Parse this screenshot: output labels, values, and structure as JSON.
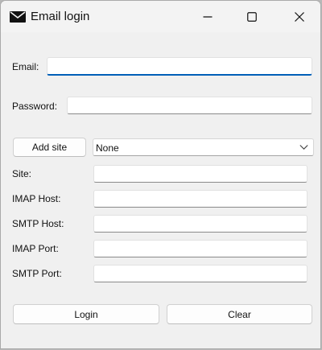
{
  "window": {
    "title": "Email login",
    "app_icon": "envelope-icon",
    "controls": [
      "minimize-icon",
      "maximize-icon",
      "close-icon"
    ]
  },
  "form": {
    "email_label": "Email:",
    "email_value": "",
    "password_label": "Password:",
    "password_value": "",
    "add_site_label": "Add site",
    "site_select": {
      "selected": "None",
      "icon": "chevron-down-icon"
    },
    "site_label": "Site:",
    "site_value": "",
    "imap_host_label": "IMAP Host:",
    "imap_host_value": "",
    "smtp_host_label": "SMTP Host:",
    "smtp_host_value": "",
    "imap_port_label": "IMAP Port:",
    "imap_port_value": "",
    "smtp_port_label": "SMTP Port:",
    "smtp_port_value": ""
  },
  "actions": {
    "login_label": "Login",
    "clear_label": "Clear"
  },
  "colors": {
    "focus_accent": "#005fb8",
    "window_bg": "#f0f0f0"
  }
}
